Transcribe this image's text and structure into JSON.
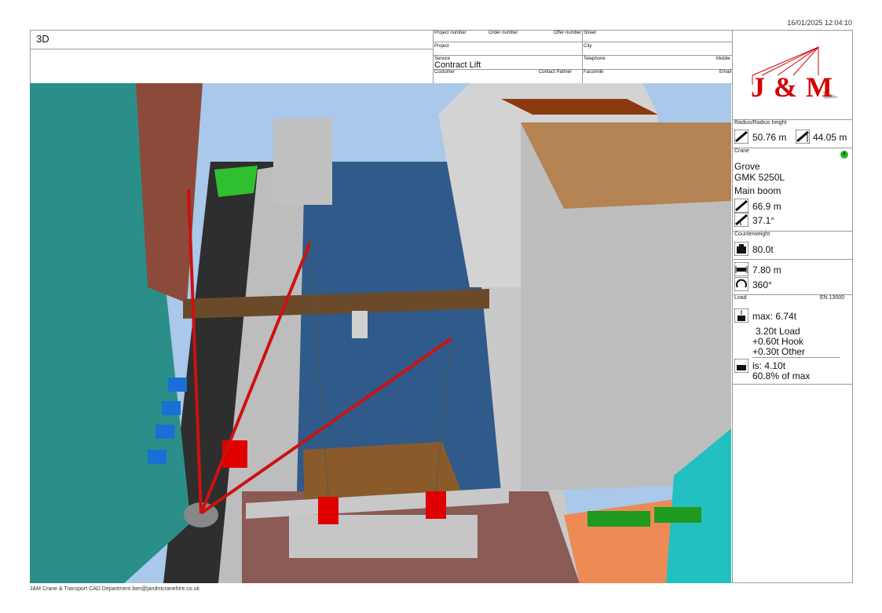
{
  "timestamp": "16/01/2025 12:04:10",
  "view_title": "3D",
  "header": {
    "project_number_label": "Project number",
    "order_number_label": "Order number",
    "offer_number_label": "Offer number",
    "street_label": "Street",
    "project_label": "Project",
    "city_label": "City",
    "service_label": "Service",
    "service_value": "Contract Lift",
    "telephone_label": "Telephone",
    "mobile_label": "Mobile",
    "customer_label": "Customer",
    "contact_partner_label": "Contact Partner",
    "facsimile_label": "Facsimile",
    "email_label": "Email"
  },
  "logo": {
    "text": "J & M",
    "color": "#d40000"
  },
  "radius": {
    "label": "Radius/Radius height",
    "radius_value": "50.76 m",
    "height_value": "44.05 m"
  },
  "crane": {
    "label": "Crane",
    "badge": "4",
    "badge_color": "#22bb22",
    "make": "Grove",
    "model": "GMK 5250L",
    "boom": "Main boom",
    "boom_length": "66.9 m",
    "boom_angle": "37.1°"
  },
  "counterweight": {
    "label": "Counterweight",
    "value": "80.0t"
  },
  "outrigger": {
    "width": "7.80 m",
    "slew": "360°"
  },
  "load": {
    "label": "Load",
    "standard": "EN 13000",
    "max": "max: 6.74t",
    "load_line": "3.20t Load",
    "hook_line": "+0.60t Hook",
    "other_line": "+0.30t Other",
    "is": "is: 4.10t",
    "percent": "60.8% of max"
  },
  "footer": "J&M Crane & Transport CAD Department ben@jandmcranehire.co.uk",
  "colors": {
    "sky": "#a9c8ea",
    "water": "#2f5a8a",
    "boom": "#cc1111",
    "glass": "#2a8f88",
    "brick": "#8b4a3a"
  }
}
